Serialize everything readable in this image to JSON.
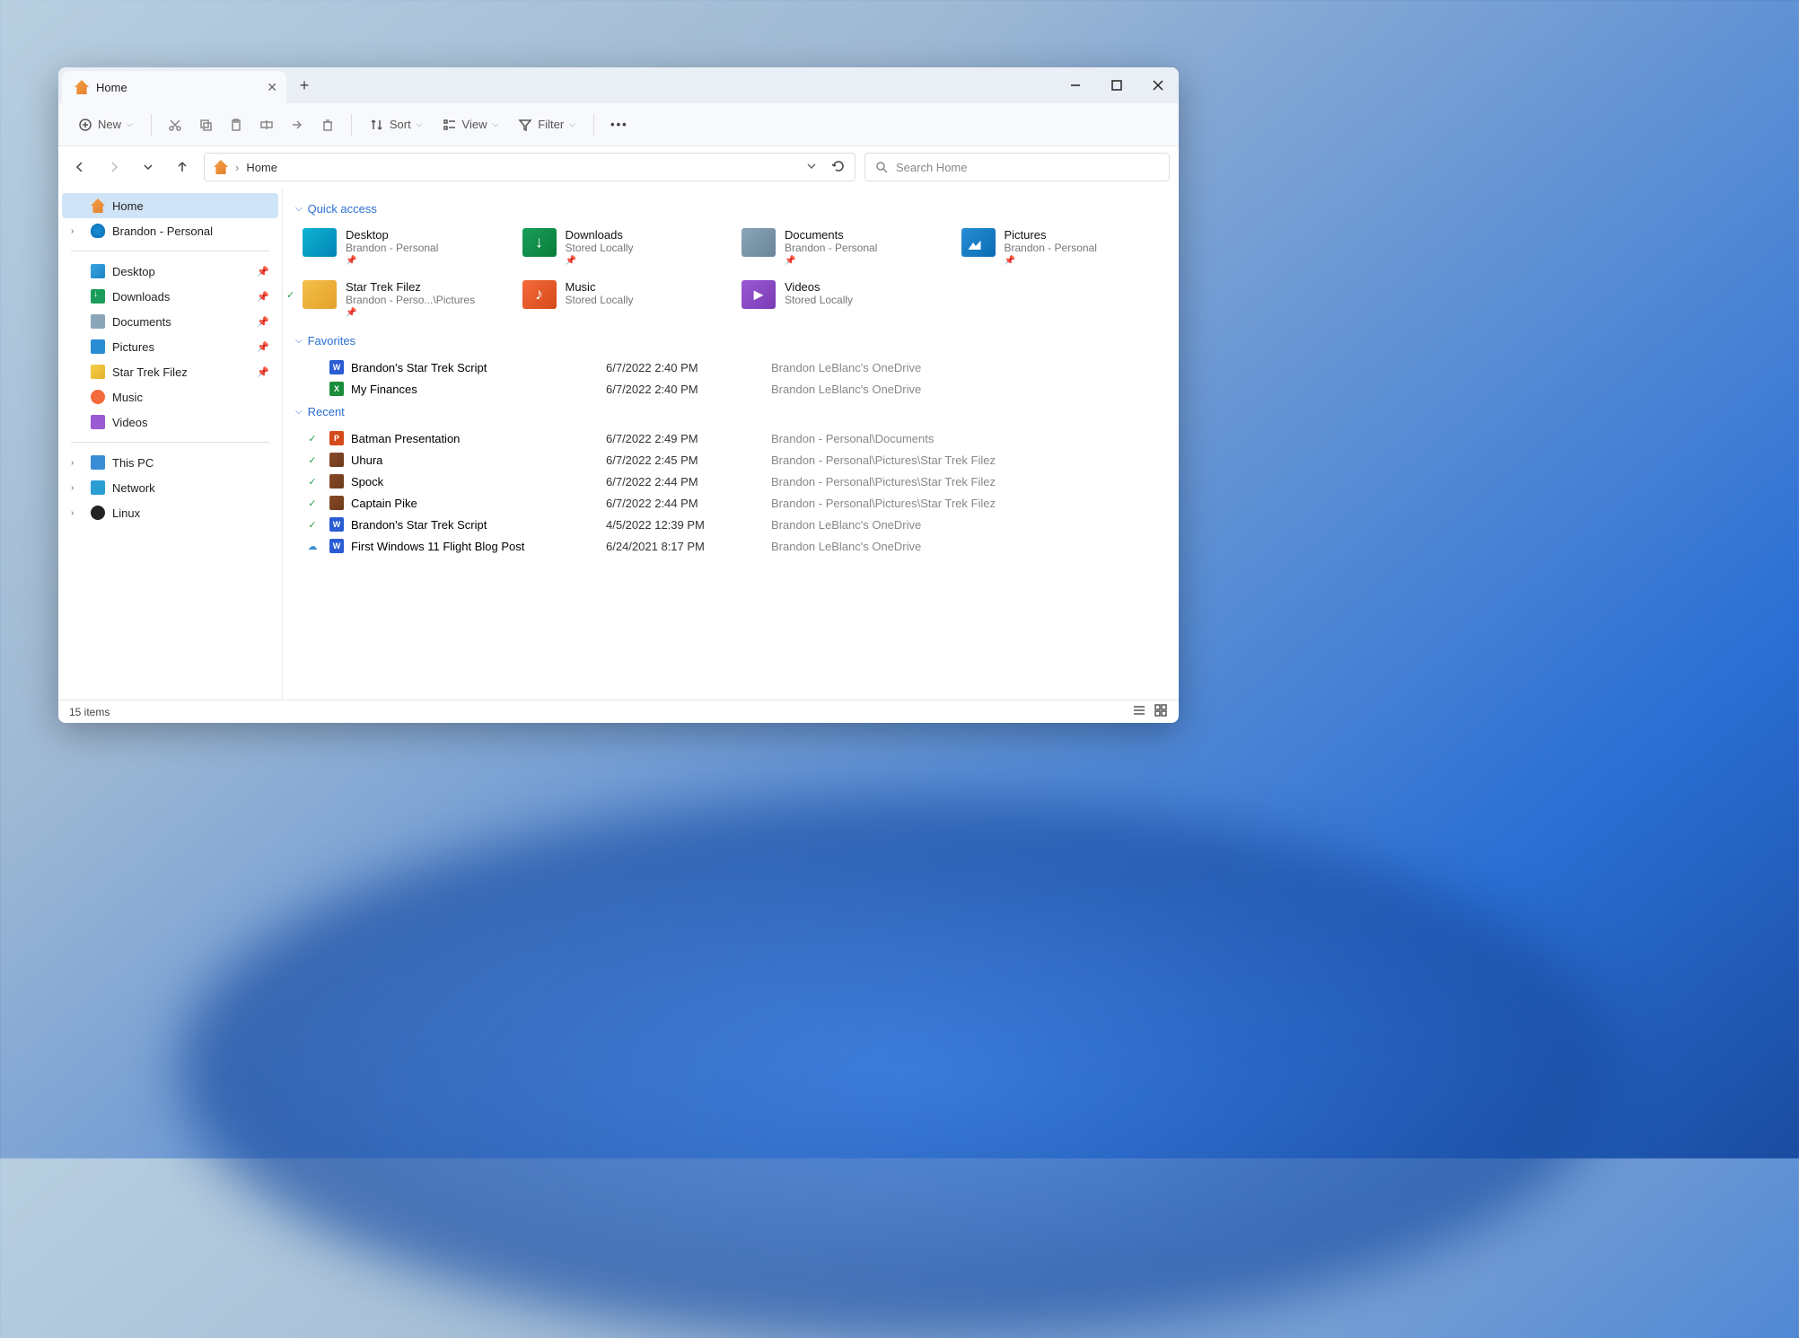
{
  "tab": {
    "title": "Home"
  },
  "toolbar": {
    "new_label": "New",
    "sort_label": "Sort",
    "view_label": "View",
    "filter_label": "Filter"
  },
  "breadcrumb": {
    "current": "Home"
  },
  "search": {
    "placeholder": "Search Home"
  },
  "sidebar": {
    "top": [
      {
        "label": "Home",
        "icon": "home",
        "active": true,
        "expandable": false
      },
      {
        "label": "Brandon - Personal",
        "icon": "onedrive",
        "active": false,
        "expandable": true
      }
    ],
    "pinned": [
      {
        "label": "Desktop",
        "icon": "desktop",
        "pinned": true
      },
      {
        "label": "Downloads",
        "icon": "downloads",
        "pinned": true
      },
      {
        "label": "Documents",
        "icon": "documents",
        "pinned": true
      },
      {
        "label": "Pictures",
        "icon": "pictures",
        "pinned": true
      },
      {
        "label": "Star Trek Filez",
        "icon": "folder",
        "pinned": true
      },
      {
        "label": "Music",
        "icon": "music",
        "pinned": false
      },
      {
        "label": "Videos",
        "icon": "videos",
        "pinned": false
      }
    ],
    "bottom": [
      {
        "label": "This PC",
        "icon": "thispc",
        "expandable": true
      },
      {
        "label": "Network",
        "icon": "network",
        "expandable": true
      },
      {
        "label": "Linux",
        "icon": "linux",
        "expandable": true
      }
    ]
  },
  "sections": {
    "quick_access": "Quick access",
    "favorites": "Favorites",
    "recent": "Recent"
  },
  "quick_access": [
    {
      "name": "Desktop",
      "sub": "Brandon - Personal",
      "icon": "desktop",
      "pinned": true
    },
    {
      "name": "Downloads",
      "sub": "Stored Locally",
      "icon": "downloads",
      "pinned": true
    },
    {
      "name": "Documents",
      "sub": "Brandon - Personal",
      "icon": "documents",
      "pinned": true
    },
    {
      "name": "Pictures",
      "sub": "Brandon - Personal",
      "icon": "pictures",
      "pinned": true
    },
    {
      "name": "Star Trek Filez",
      "sub": "Brandon - Perso...\\Pictures",
      "icon": "startrek",
      "pinned": true,
      "synced": true
    },
    {
      "name": "Music",
      "sub": "Stored Locally",
      "icon": "music",
      "pinned": false
    },
    {
      "name": "Videos",
      "sub": "Stored Locally",
      "icon": "videos",
      "pinned": false
    }
  ],
  "favorites": [
    {
      "name": "Brandon's Star Trek Script",
      "date": "6/7/2022 2:40 PM",
      "location": "Brandon LeBlanc's OneDrive",
      "icon": "word"
    },
    {
      "name": "My Finances",
      "date": "6/7/2022 2:40 PM",
      "location": "Brandon LeBlanc's OneDrive",
      "icon": "excel"
    }
  ],
  "recent": [
    {
      "name": "Batman Presentation",
      "date": "6/7/2022 2:49 PM",
      "location": "Brandon - Personal\\Documents",
      "icon": "ppt",
      "sync": "check"
    },
    {
      "name": "Uhura",
      "date": "6/7/2022 2:45 PM",
      "location": "Brandon - Personal\\Pictures\\Star Trek Filez",
      "icon": "img",
      "sync": "check"
    },
    {
      "name": "Spock",
      "date": "6/7/2022 2:44 PM",
      "location": "Brandon - Personal\\Pictures\\Star Trek Filez",
      "icon": "img",
      "sync": "check"
    },
    {
      "name": "Captain Pike",
      "date": "6/7/2022 2:44 PM",
      "location": "Brandon - Personal\\Pictures\\Star Trek Filez",
      "icon": "img",
      "sync": "check"
    },
    {
      "name": "Brandon's Star Trek Script",
      "date": "4/5/2022 12:39 PM",
      "location": "Brandon LeBlanc's OneDrive",
      "icon": "word",
      "sync": "check"
    },
    {
      "name": "First Windows 11 Flight Blog Post",
      "date": "6/24/2021 8:17 PM",
      "location": "Brandon LeBlanc's OneDrive",
      "icon": "word",
      "sync": "cloud"
    }
  ],
  "statusbar": {
    "count": "15 items"
  }
}
